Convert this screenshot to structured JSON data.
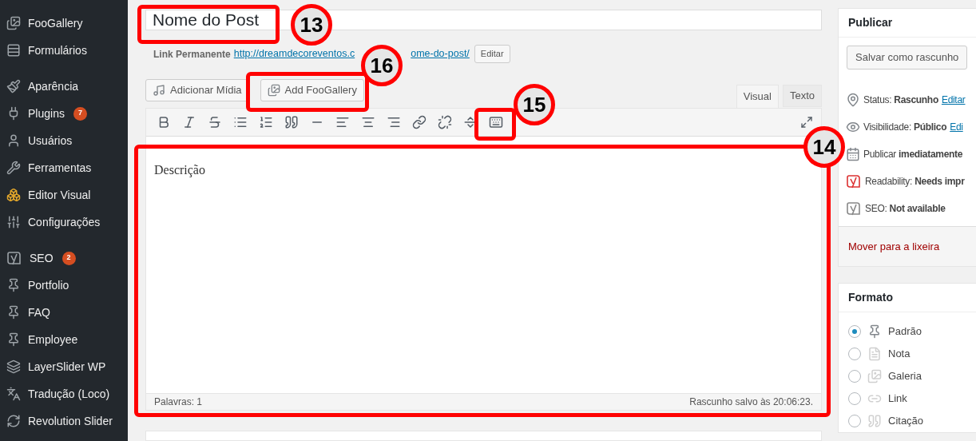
{
  "sidebar": {
    "groups": [
      {
        "items": [
          {
            "kind": "gallery",
            "label": "FooGallery"
          },
          {
            "kind": "forms",
            "label": "Formulários"
          }
        ]
      },
      {
        "items": [
          {
            "kind": "appearance",
            "label": "Aparência"
          },
          {
            "kind": "plugins",
            "label": "Plugins",
            "badge": "7"
          },
          {
            "kind": "users",
            "label": "Usuários"
          },
          {
            "kind": "tools",
            "label": "Ferramentas"
          },
          {
            "kind": "builder",
            "label": "Editor Visual"
          },
          {
            "kind": "settings",
            "label": "Configurações"
          }
        ]
      },
      {
        "items": [
          {
            "kind": "seo",
            "label": "SEO",
            "badge": "2"
          },
          {
            "kind": "pin",
            "label": "Portfolio"
          },
          {
            "kind": "pin",
            "label": "FAQ"
          },
          {
            "kind": "pin",
            "label": "Employee"
          },
          {
            "kind": "layers",
            "label": "LayerSlider WP"
          },
          {
            "kind": "translate",
            "label": "Tradução (Loco)"
          },
          {
            "kind": "refresh",
            "label": "Revolution Slider"
          }
        ]
      }
    ]
  },
  "title": {
    "value": "Nome do Post"
  },
  "permalink": {
    "label": "Link Permanente",
    "link_parts": [
      "http://dreamdecoreventos.c",
      "ome-do-post/"
    ],
    "button": "Editar"
  },
  "media_buttons": [
    {
      "kind": "media",
      "label": "Adicionar Mídia"
    },
    {
      "kind": "gallery",
      "label": "Add FooGallery"
    }
  ],
  "editor_tabs": [
    {
      "label": "Visual",
      "selected": true
    },
    {
      "label": "Texto",
      "selected": false
    }
  ],
  "editor": {
    "content": "Descrição",
    "word_count": "Palavras: 1",
    "saved": "Rascunho salvo às 20:06:23."
  },
  "callouts": [
    {
      "number": "13"
    },
    {
      "number": "16"
    },
    {
      "number": "15"
    },
    {
      "number": "14"
    }
  ],
  "publish": {
    "title": "Publicar",
    "save_button": "Salvar como rascunho",
    "rows": [
      {
        "kind": "status",
        "label": "Status:",
        "value": "Rascunho",
        "link": "Editar"
      },
      {
        "kind": "visibility",
        "label": "Visibilidade:",
        "value": "Público",
        "link": "Edi"
      },
      {
        "kind": "schedule",
        "label": "Publicar",
        "value": "imediatamente"
      },
      {
        "kind": "readability",
        "label": "Readability:",
        "value": "Needs impr"
      },
      {
        "kind": "seo",
        "label": "SEO:",
        "value": "Not available"
      }
    ],
    "trash": "Mover para a lixeira"
  },
  "format": {
    "title": "Formato",
    "options": [
      {
        "kind": "standard",
        "label": "Padrão",
        "selected": true
      },
      {
        "kind": "aside",
        "label": "Nota",
        "selected": false
      },
      {
        "kind": "gallery",
        "label": "Galeria",
        "selected": false
      },
      {
        "kind": "link",
        "label": "Link",
        "selected": false
      },
      {
        "kind": "quote",
        "label": "Citação",
        "selected": false
      }
    ]
  }
}
